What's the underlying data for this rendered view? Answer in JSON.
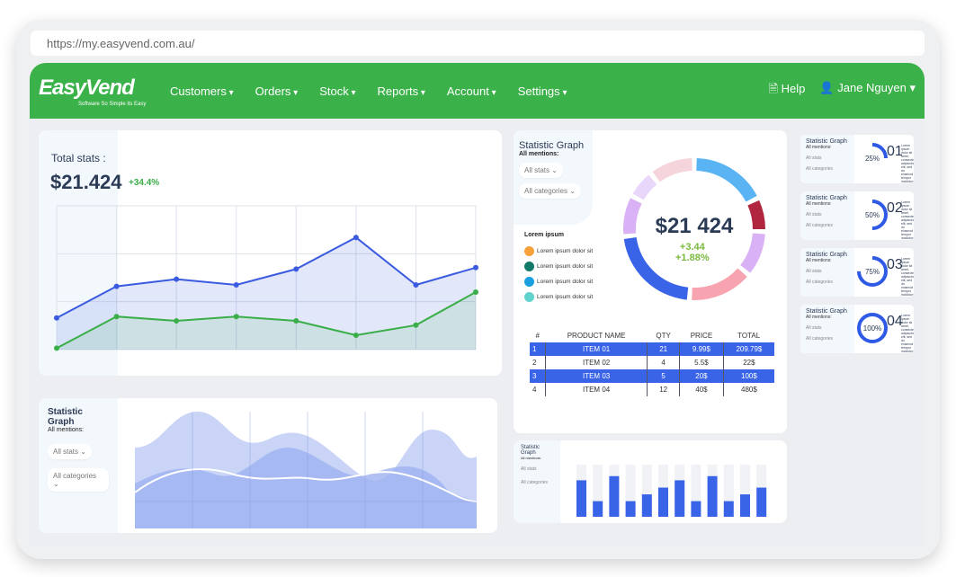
{
  "browser": {
    "url": "https://my.easyvend.com.au/"
  },
  "brand": {
    "name": "EasyVend",
    "tagline": "Software So Simple its Easy",
    "color": "#3bb14a"
  },
  "nav": {
    "items": [
      "Customers",
      "Orders",
      "Stock",
      "Reports",
      "Account",
      "Settings"
    ],
    "help": "Help",
    "user": "Jane Nguyen"
  },
  "total_stats": {
    "title": "Total stats :",
    "value": "$21.424",
    "change": "+34.4%",
    "chart_data": {
      "type": "line",
      "series": [
        {
          "values": [
            22,
            44,
            49,
            45,
            56,
            78,
            45,
            57
          ],
          "color": "#3a5be0"
        },
        {
          "values": [
            1,
            23,
            20,
            23,
            20,
            10,
            17,
            40
          ],
          "color": "#3aae48"
        }
      ]
    }
  },
  "stat_graph_main": {
    "title": "Statistic Graph",
    "subtitle": "All mentions:",
    "dropdowns": [
      "All stats",
      "All categories"
    ],
    "total": "$21 424",
    "change1": "+3.44",
    "change2": "+1.88%",
    "legend_title": "Lorem ipsum",
    "legend": [
      {
        "label": "Lorem ipsum  dolor sit",
        "color": "#f7a13b"
      },
      {
        "label": "Lorem ipsum  dolor sit",
        "color": "#137a6a"
      },
      {
        "label": "Lorem ipsum  dolor sit",
        "color": "#1aa0e0"
      },
      {
        "label": "Lorem ipsum  dolor sit",
        "color": "#5fd3cc"
      }
    ],
    "donut_colors": [
      "#5ab4f3",
      "#b0263f",
      "#d9b2f5",
      "#f8a3b0",
      "#3a64e8",
      "#d9b2f5",
      "#e9d6fb",
      "#f6d4dc"
    ],
    "table": {
      "headers": [
        "#",
        "PRODUCT NAME",
        "QTY",
        "PRICE",
        "TOTAL"
      ],
      "rows": [
        [
          "1",
          "ITEM 01",
          "21",
          "9.99$",
          "209.79$"
        ],
        [
          "2",
          "ITEM 02",
          "4",
          "5.5$",
          "22$"
        ],
        [
          "3",
          "ITEM 03",
          "5",
          "20$",
          "100$"
        ],
        [
          "4",
          "ITEM 04",
          "12",
          "40$",
          "480$"
        ]
      ]
    }
  },
  "wave_graph": {
    "title": "Statistic Graph",
    "subtitle": "All mentions:",
    "dropdowns": [
      "All stats",
      "All categories"
    ]
  },
  "bar_graph": {
    "title": "Statistic Graph",
    "subtitle": "All mentions:",
    "dropdowns": [
      "All stats",
      "All categories"
    ],
    "chart_data": {
      "type": "bar",
      "values": [
        70,
        30,
        78,
        30,
        43,
        56,
        70,
        30,
        78,
        30,
        43,
        56
      ],
      "color": "#3a64e8"
    }
  },
  "mini_cards": [
    {
      "title": "Statistic Graph",
      "subtitle": "All mentions:",
      "dropdowns": [
        "All stats",
        "All categories"
      ],
      "percent": "25%",
      "progress": 25,
      "number": "01",
      "text": "Lorem ipsum dolor sit amet, consectetur adipiscing elit, sed do eiusmod tempor incididunt ut labore et dolore magna aliqua."
    },
    {
      "title": "Statistic Graph",
      "subtitle": "All mentions:",
      "dropdowns": [
        "All stats",
        "All categories"
      ],
      "percent": "50%",
      "progress": 50,
      "number": "02",
      "text": "Lorem ipsum dolor sit amet, consectetur adipiscing elit, sed do eiusmod tempor incididunt ut labore et dolore magna aliqua."
    },
    {
      "title": "Statistic Graph",
      "subtitle": "All mentions:",
      "dropdowns": [
        "All stats",
        "All categories"
      ],
      "percent": "75%",
      "progress": 75,
      "number": "03",
      "text": "Lorem ipsum dolor sit amet, consectetur adipiscing elit, sed do eiusmod tempor incididunt ut labore et dolore magna aliqua."
    },
    {
      "title": "Statistic Graph",
      "subtitle": "All mentions:",
      "dropdowns": [
        "All stats",
        "All categories"
      ],
      "percent": "100%",
      "progress": 100,
      "number": "04",
      "text": "Lorem ipsum dolor sit amet, consectetur adipiscing elit, sed do eiusmod tempor incididunt ut labore et dolore magna aliqua."
    }
  ]
}
